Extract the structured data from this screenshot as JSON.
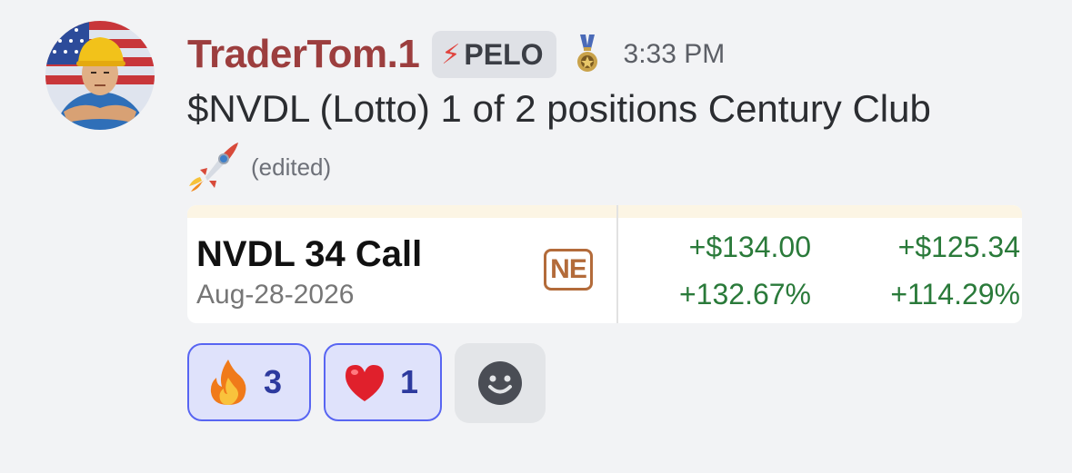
{
  "message": {
    "username": "TraderTom.1",
    "tag": {
      "icon": "⚡",
      "text": "PELO"
    },
    "badge_icon": "medal-icon",
    "timestamp": "3:33 PM",
    "text": "$NVDL (Lotto)  1 of 2 positions Century Club",
    "emoji": "rocket",
    "edited": "(edited)"
  },
  "card": {
    "contract": "NVDL 34 Call",
    "expiry": "Aug-28-2026",
    "badge": "NE",
    "pnl_dollar_1": "+$134.00",
    "pnl_pct_1": "+132.67%",
    "pnl_dollar_2": "+$125.34",
    "pnl_pct_2": "+114.29%",
    "colors": {
      "positive": "#2a7a3a",
      "badge": "#b36b3a"
    }
  },
  "reactions": [
    {
      "emoji": "fire",
      "count": "3"
    },
    {
      "emoji": "heart",
      "count": "1"
    }
  ],
  "add_reaction_icon": "smiley-icon",
  "colors": {
    "username": "#9c3e3e",
    "reaction_border": "#5865f2"
  }
}
